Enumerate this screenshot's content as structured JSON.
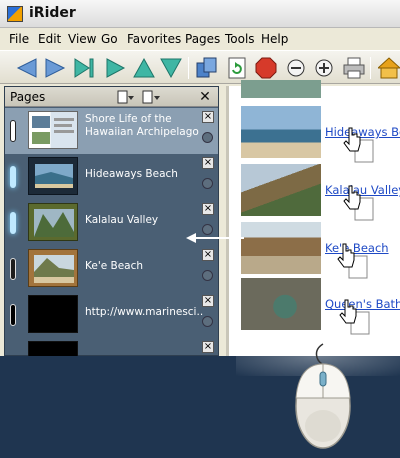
{
  "app": {
    "title": "iRider"
  },
  "menu": [
    "File",
    "Edit",
    "View",
    "Go",
    "Favorites",
    "Pages",
    "Tools",
    "Help"
  ],
  "toolbar": {
    "buttons": [
      "back-icon",
      "forward-icon",
      "skip-forward-icon",
      "play-icon",
      "up-icon",
      "down-icon",
      "pages-icon",
      "refresh-icon",
      "stop-icon",
      "zoom-out-icon",
      "zoom-in-icon",
      "print-icon",
      "home-icon"
    ]
  },
  "pages_panel": {
    "title": "Pages",
    "close_symbol": "✕",
    "items": [
      {
        "label": "Shore Life of the Hawaiian Archipelago"
      },
      {
        "label": "Hideaways Beach"
      },
      {
        "label": "Kalalau Valley"
      },
      {
        "label": "Ke'e Beach"
      },
      {
        "label": "http://www.marinesci..."
      },
      {
        "label": ""
      }
    ]
  },
  "content": {
    "links": [
      "Hideaways Beach",
      "Kalalau Valley",
      "Ke'e Beach",
      "Queen's Bath"
    ]
  },
  "colors": {
    "accent": "#1e49c5",
    "panel": "#4a5f74",
    "selected": "#8b9fb2",
    "background": "#1f3550"
  }
}
